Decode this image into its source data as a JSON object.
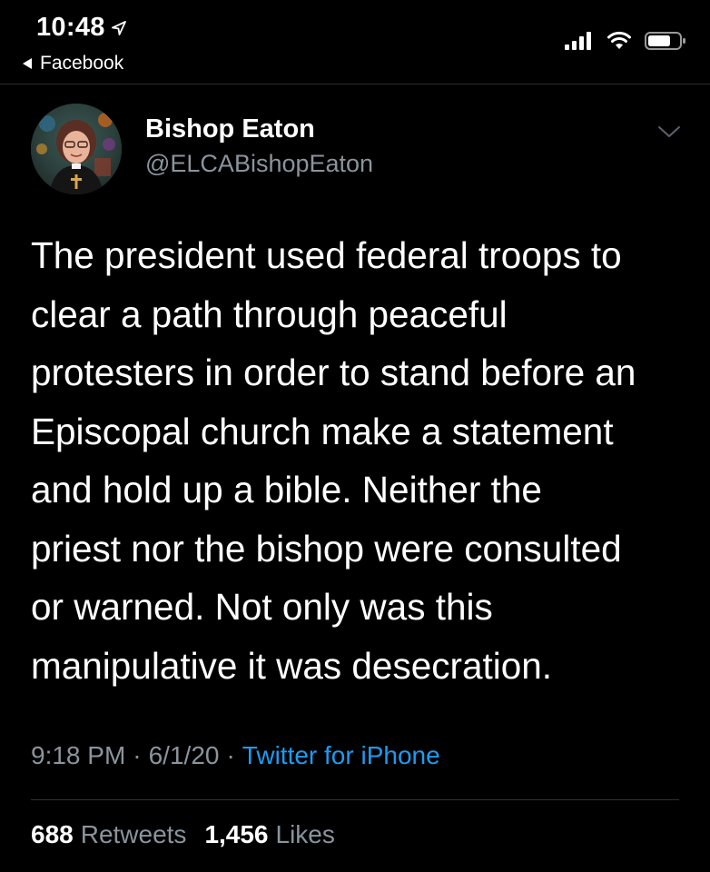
{
  "status_bar": {
    "time": "10:48",
    "back_label": "Facebook",
    "icons": [
      "location-arrow-icon",
      "signal-icon",
      "wifi-icon",
      "battery-icon"
    ]
  },
  "tweet": {
    "author_name": "Bishop Eaton",
    "author_handle": "@ELCABishopEaton",
    "text_lines": [
      "The president used federal troops to",
      "clear a path through peaceful",
      "protesters in order to stand before an",
      "Episcopal church make a statement",
      "and hold up a bible. Neither the",
      "priest nor the bishop were consulted",
      "or warned. Not only was this",
      "manipulative it was desecration."
    ],
    "time": "9:18 PM",
    "date": "6/1/20",
    "separator": "·",
    "source": "Twitter for iPhone",
    "retweets_count": "688",
    "retweets_label": "Retweets",
    "likes_count": "1,456",
    "likes_label": "Likes"
  },
  "colors": {
    "background": "#000000",
    "text": "#ffffff",
    "secondary_text": "#8a949c",
    "link": "#1d9bf0"
  }
}
